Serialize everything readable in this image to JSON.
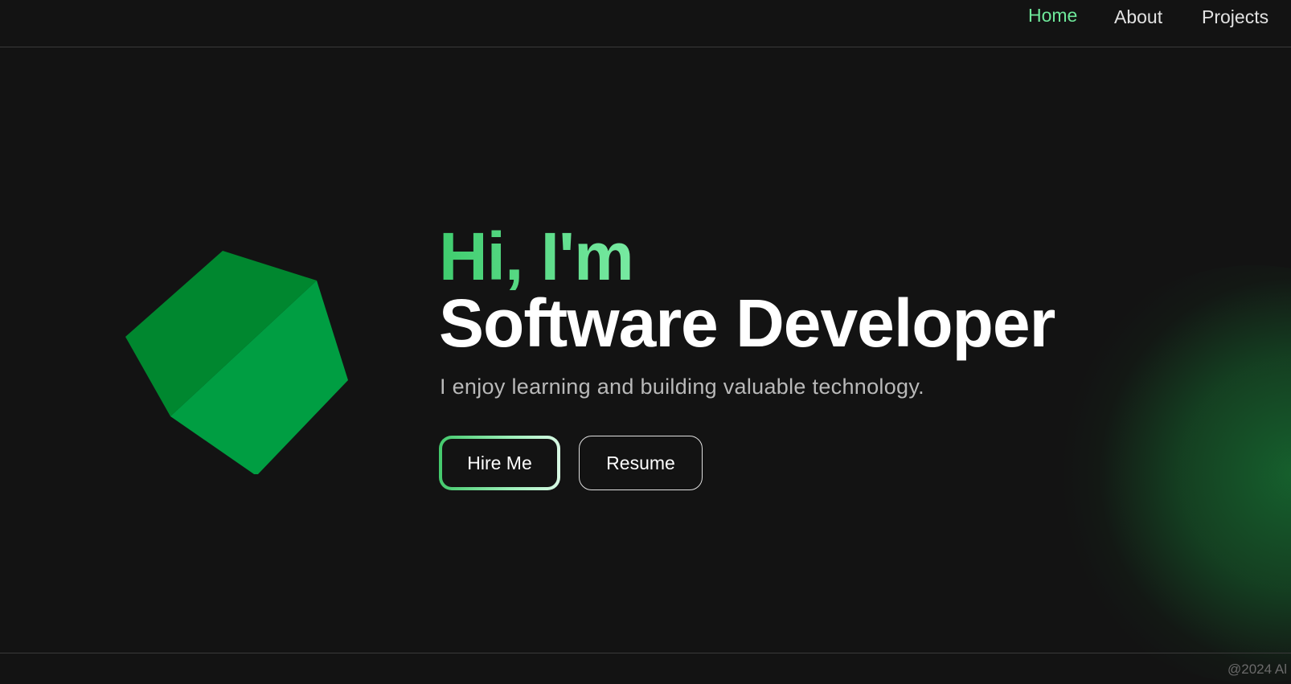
{
  "nav": {
    "items": [
      {
        "label": "Home",
        "active": true
      },
      {
        "label": "About",
        "active": false
      },
      {
        "label": "Projects",
        "active": false
      }
    ]
  },
  "hero": {
    "greeting": "Hi, I'm",
    "title": "Software Developer",
    "subtitle": "I enjoy learning and building valuable technology.",
    "buttons": {
      "hire_label": "Hire Me",
      "resume_label": "Resume"
    }
  },
  "footer": {
    "text": "@2024 Al"
  },
  "colors": {
    "background": "#131313",
    "accent": "#6ee89a",
    "cube_light": "#009e42",
    "cube_dark": "#00872f"
  },
  "icons": {
    "cube": "green-3d-cube"
  }
}
